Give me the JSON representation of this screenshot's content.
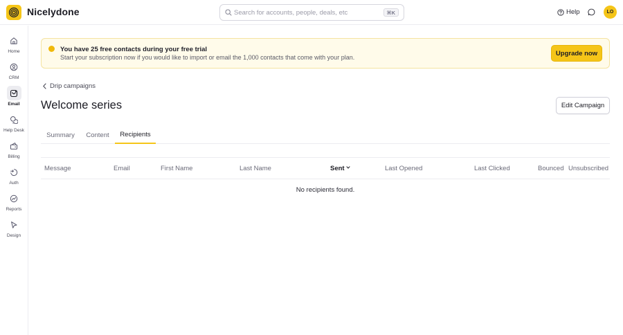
{
  "app": {
    "name": "Nicelydone",
    "logo_icon": "spiral-logo-icon",
    "accent": "#f5c518"
  },
  "search": {
    "placeholder": "Search for accounts, people, deals, etc",
    "value": "",
    "shortcut": "⌘K"
  },
  "header": {
    "help_label": "Help",
    "avatar_initials": "LO"
  },
  "sidebar": {
    "items": [
      {
        "label": "Home",
        "icon": "home-icon",
        "active": false
      },
      {
        "label": "CRM",
        "icon": "crm-icon",
        "active": false
      },
      {
        "label": "Email",
        "icon": "email-icon",
        "active": true
      },
      {
        "label": "Help Desk",
        "icon": "help-desk-icon",
        "active": false
      },
      {
        "label": "Billing",
        "icon": "billing-icon",
        "active": false
      },
      {
        "label": "Auth",
        "icon": "auth-icon",
        "active": false
      },
      {
        "label": "Reports",
        "icon": "reports-icon",
        "active": false
      },
      {
        "label": "Design",
        "icon": "design-icon",
        "active": false
      }
    ]
  },
  "banner": {
    "title": "You have 25 free contacts during your free trial",
    "text": "Start your subscription now if you would like to import or email the 1,000 contacts that come with your plan.",
    "button_label": "Upgrade now"
  },
  "breadcrumb": {
    "label": "Drip campaigns"
  },
  "page": {
    "title": "Welcome series",
    "edit_label": "Edit Campaign"
  },
  "tabs": [
    {
      "label": "Summary",
      "active": false
    },
    {
      "label": "Content",
      "active": false
    },
    {
      "label": "Recipients",
      "active": true
    }
  ],
  "table": {
    "columns": [
      {
        "label": "Message",
        "sorted": false
      },
      {
        "label": "Email",
        "sorted": false
      },
      {
        "label": "First Name",
        "sorted": false
      },
      {
        "label": "Last Name",
        "sorted": false
      },
      {
        "label": "Sent",
        "sorted": true
      },
      {
        "label": "Last Opened",
        "sorted": false
      },
      {
        "label": "Last Clicked",
        "sorted": false
      },
      {
        "label": "Bounced",
        "sorted": false
      },
      {
        "label": "Unsubscribed",
        "sorted": false
      }
    ],
    "empty_message": "No recipients found."
  }
}
